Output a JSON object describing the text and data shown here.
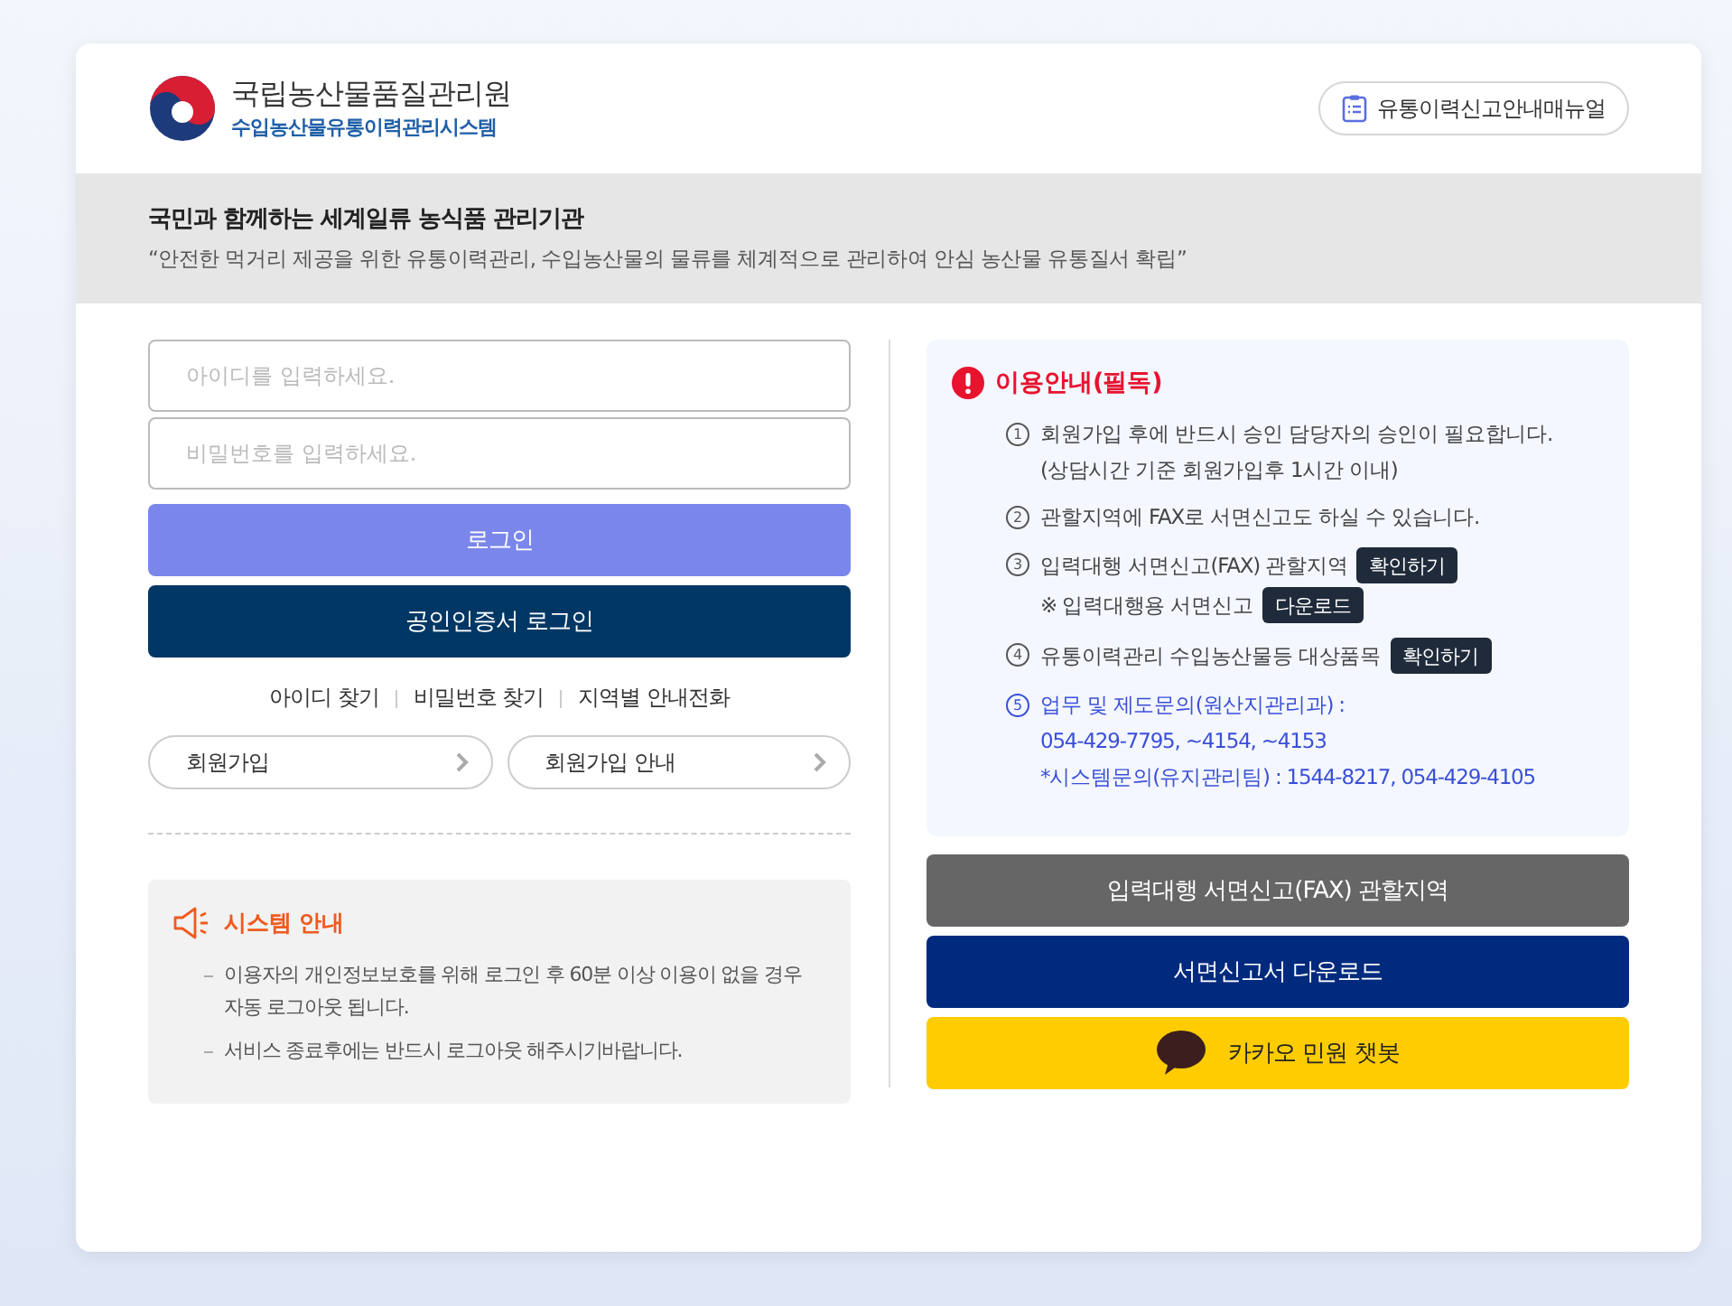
{
  "header": {
    "org_name": "국립농산물품질관리원",
    "system_name": "수입농산물유통이력관리시스템",
    "manual_button": "유통이력신고안내매뉴얼"
  },
  "banner": {
    "title": "국민과 함께하는 세계일류 농식품 관리기관",
    "slogan": "“안전한 먹거리 제공을 위한 유통이력관리, 수입농산물의 물류를 체계적으로 관리하여 안심 농산물 유통질서 확립”"
  },
  "login": {
    "id_field": {
      "placeholder": "아이디를 입력하세요."
    },
    "password_field": {
      "placeholder": "비밀번호를 입력하세요."
    },
    "login_button": "로그인",
    "cert_login_button": "공인인증서 로그인",
    "links": [
      "아이디 찾기",
      "비밀번호 찾기",
      "지역별 안내전화"
    ],
    "join_buttons": [
      "회원가입",
      "회원가입 안내"
    ]
  },
  "system_notice": {
    "title": "시스템 안내",
    "items": [
      "이용자의 개인정보보호를 위해 로그인 후 60분 이상 이용이 없을 경우 자동 로그아웃 됩니다.",
      "서비스 종료후에는 반드시 로그아웃 해주시기바랍니다."
    ]
  },
  "usage_guide": {
    "title": "이용안내(필독)",
    "items": [
      {
        "number": "1",
        "highlighted": false,
        "lines": [
          {
            "text": "회원가입 후에 반드시 승인 담당자의 승인이 필요합니다."
          },
          {
            "text": "(상담시간 기준 회원가입후 1시간 이내)"
          }
        ]
      },
      {
        "number": "2",
        "highlighted": false,
        "lines": [
          {
            "text": "관할지역에 FAX로 서면신고도 하실 수 있습니다."
          }
        ]
      },
      {
        "number": "3",
        "highlighted": false,
        "lines": [
          {
            "text": "입력대행 서면신고(FAX) 관할지역",
            "button": "확인하기"
          },
          {
            "text": "※ 입력대행용 서면신고",
            "button": "다운로드"
          }
        ]
      },
      {
        "number": "4",
        "highlighted": false,
        "lines": [
          {
            "text": "유통이력관리 수입농산물등 대상품목",
            "button": "확인하기"
          }
        ]
      },
      {
        "number": "5",
        "highlighted": true,
        "lines": [
          {
            "text": "업무 및 제도문의(원산지관리과) :"
          },
          {
            "text": "054-429-7795, ~4154, ~4153"
          },
          {
            "text": "*시스템문의(유지관리팀) : 1544-8217,  054-429-4105"
          }
        ]
      }
    ]
  },
  "action_buttons": [
    {
      "kind": "fax",
      "label": "입력대행 서면신고(FAX) 관할지역"
    },
    {
      "kind": "download",
      "label": "서면신고서 다운로드"
    },
    {
      "kind": "kakao",
      "label": "카카오 민원 챗봇"
    }
  ]
}
